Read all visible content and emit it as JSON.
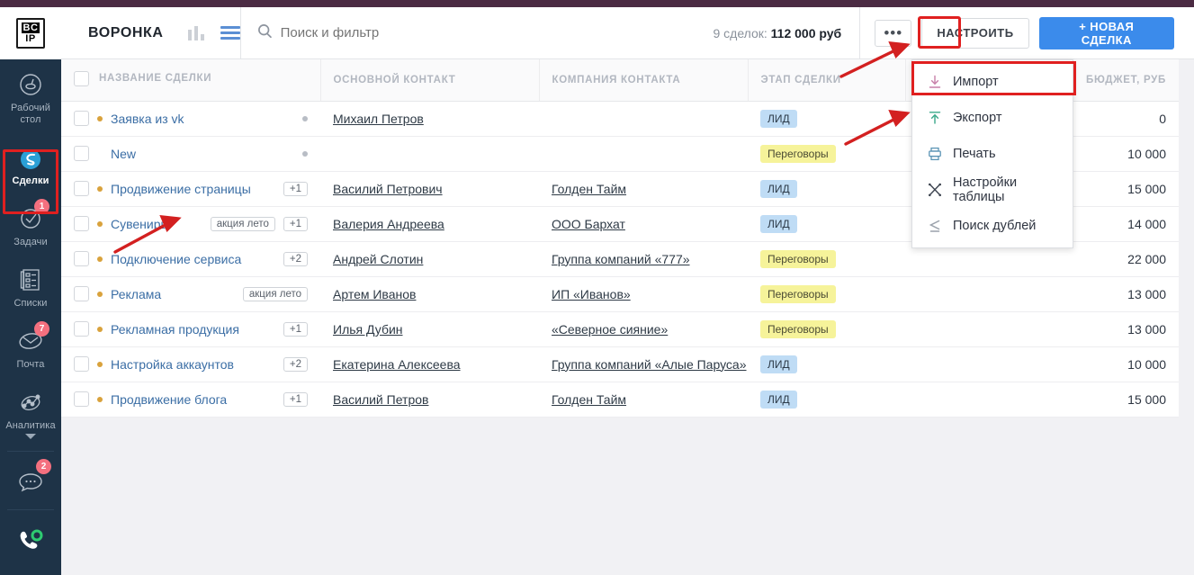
{
  "app": {
    "logo_top": "BC",
    "logo_bottom": "IP",
    "page_title": "ВОРОНКА"
  },
  "sidebar": {
    "items": [
      {
        "label": "Рабочий\nстол",
        "icon": "dashboard-icon",
        "badge": "",
        "active": false
      },
      {
        "label": "Сделки",
        "icon": "deals-icon",
        "badge": "",
        "active": true
      },
      {
        "label": "Задачи",
        "icon": "tasks-icon",
        "badge": "1",
        "active": false
      },
      {
        "label": "Списки",
        "icon": "lists-icon",
        "badge": "",
        "active": false
      },
      {
        "label": "Почта",
        "icon": "mail-icon",
        "badge": "7",
        "active": false
      },
      {
        "label": "Аналитика",
        "icon": "analytics-icon",
        "badge": "",
        "active": false
      }
    ],
    "chat": {
      "label": "",
      "icon": "chat-icon",
      "badge": "2"
    },
    "phone": {
      "label": "",
      "icon": "phone-icon"
    }
  },
  "search": {
    "placeholder": "Поиск и фильтр",
    "value": "",
    "icon": "search-icon"
  },
  "toolbar": {
    "summary_prefix": "9 сделок: ",
    "summary_value": "112 000 руб",
    "dots_label": "•••",
    "configure_label": "НАСТРОИТЬ",
    "new_deal_label": "+ НОВАЯ СДЕЛКА",
    "accent_color": "#3b8beb",
    "highlight_color": "#e02020"
  },
  "dropdown": {
    "items": [
      {
        "label": "Импорт",
        "icon": "import-icon",
        "highlighted": true
      },
      {
        "label": "Экспорт",
        "icon": "export-icon",
        "highlighted": false
      },
      {
        "label": "Печать",
        "icon": "print-icon",
        "highlighted": false
      },
      {
        "label": "Настройки таблицы",
        "icon": "table-settings-icon",
        "highlighted": false
      },
      {
        "label": "Поиск дублей",
        "icon": "find-duplicates-icon",
        "highlighted": false
      }
    ]
  },
  "table": {
    "columns": [
      "НАЗВАНИЕ СДЕЛКИ",
      "ОСНОВНОЙ КОНТАКТ",
      "КОМПАНИЯ КОНТАКТА",
      "ЭТАП СДЕЛКИ",
      "БЮДЖЕТ, РУБ"
    ],
    "rows": [
      {
        "dot": true,
        "name": "Заявка из vk",
        "tags": [],
        "marker": true,
        "contact": "Михаил Петров",
        "company": "",
        "stage": "ЛИД",
        "stage_type": "lead",
        "budget": "0"
      },
      {
        "dot": false,
        "name": "New",
        "tags": [],
        "marker": true,
        "contact": "",
        "company": "",
        "stage": "Переговоры",
        "stage_type": "nego",
        "budget": "10 000"
      },
      {
        "dot": true,
        "name": "Продвижение страницы",
        "tags": [
          "+1"
        ],
        "marker": false,
        "contact": "Василий Петрович",
        "company": "Голден Тайм",
        "stage": "ЛИД",
        "stage_type": "lead",
        "budget": "15 000"
      },
      {
        "dot": true,
        "name": "Сувениры",
        "tags": [
          "акция лето",
          "+1"
        ],
        "marker": false,
        "contact": "Валерия Андреева",
        "company": "ООО Бархат",
        "stage": "ЛИД",
        "stage_type": "lead",
        "budget": "14 000"
      },
      {
        "dot": true,
        "name": "Подключение сервиса",
        "tags": [
          "+2"
        ],
        "marker": false,
        "contact": "Андрей Слотин",
        "company": "Группа компаний «777»",
        "stage": "Переговоры",
        "stage_type": "nego",
        "budget": "22 000"
      },
      {
        "dot": true,
        "name": "Реклама",
        "tags": [
          "акция лето"
        ],
        "marker": false,
        "contact": "Артем Иванов",
        "company": "ИП «Иванов»",
        "stage": "Переговоры",
        "stage_type": "nego",
        "budget": "13 000"
      },
      {
        "dot": true,
        "name": "Рекламная продукция",
        "tags": [
          "+1"
        ],
        "marker": false,
        "contact": "Илья Дубин",
        "company": "«Северное сияние»",
        "stage": "Переговоры",
        "stage_type": "nego",
        "budget": "13 000"
      },
      {
        "dot": true,
        "name": "Настройка аккаунтов",
        "tags": [
          "+2"
        ],
        "marker": false,
        "contact": "Екатерина Алексеева",
        "company": "Группа компаний «Алые Паруса»",
        "stage": "ЛИД",
        "stage_type": "lead",
        "budget": "10 000"
      },
      {
        "dot": true,
        "name": "Продвижение блога",
        "tags": [
          "+1"
        ],
        "marker": false,
        "contact": "Василий Петров",
        "company": "Голден Тайм",
        "stage": "ЛИД",
        "stage_type": "lead",
        "budget": "15 000"
      }
    ]
  },
  "view_switch": {
    "kanban_icon": "kanban-view-icon",
    "list_icon": "list-view-icon"
  }
}
